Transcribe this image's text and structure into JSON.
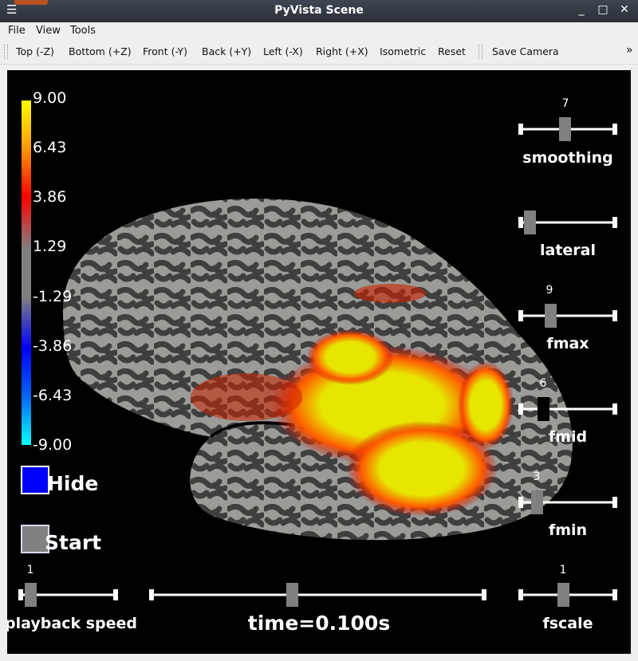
{
  "window": {
    "title": "PyVista Scene",
    "menu_icon": "hamburger-icon",
    "minimize": "_",
    "maximize": "□",
    "close": "✕"
  },
  "menu": {
    "file": "File",
    "view": "View",
    "tools": "Tools"
  },
  "toolbar": {
    "top": "Top (-Z)",
    "bottom": "Bottom (+Z)",
    "front": "Front (-Y)",
    "back": "Back (+Y)",
    "left": "Left (-X)",
    "right": "Right (+X)",
    "isometric": "Isometric",
    "reset": "Reset",
    "save_camera": "Save Camera",
    "more": "»"
  },
  "colorbar": {
    "ticks": [
      "9.00",
      "6.43",
      "3.86",
      "1.29",
      "-1.29",
      "-3.86",
      "-6.43",
      "-9.00"
    ],
    "colors": {
      "top": "#ffff00",
      "high": "#ff9900",
      "mid_high": "#ff0000",
      "neutral": "#808080",
      "mid_low": "#0000ff",
      "bottom": "#00ffff"
    }
  },
  "widgets": {
    "smoothing": {
      "label": "smoothing",
      "value": "7"
    },
    "lateral": {
      "label": "lateral"
    },
    "fmax": {
      "label": "fmax",
      "value": "9"
    },
    "fmid": {
      "label": "fmid",
      "value": "6"
    },
    "fmin": {
      "label": "fmin",
      "value": "3"
    },
    "playback": {
      "label": "playback speed",
      "value": "1"
    },
    "time": {
      "label": "time=0.100s"
    },
    "fscale": {
      "label": "fscale",
      "value": "1"
    },
    "hide": {
      "label": "Hide",
      "state": "on",
      "color": "#0000ff"
    },
    "start": {
      "label": "Start",
      "state": "off",
      "color": "#808080"
    }
  },
  "scene": {
    "background": "#000000",
    "brain_light": "#9b9b97",
    "brain_dark": "#3f3f3f",
    "activation": "#e6e600"
  }
}
